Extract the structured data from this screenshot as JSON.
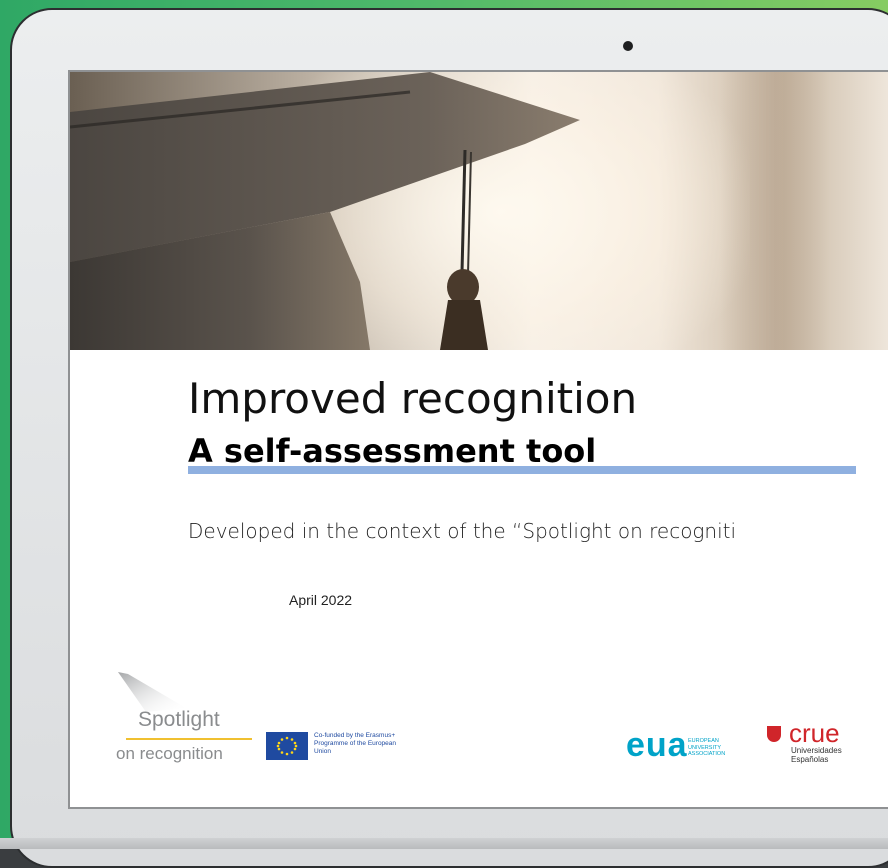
{
  "document": {
    "title": "Improved recognition",
    "subtitle": "A self-assessment tool",
    "context_text": "Developed in the context of the “Spotlight on recogniti",
    "date": "April 2022"
  },
  "logos": {
    "spotlight": {
      "line1": "Spotlight",
      "line2": "on recognition"
    },
    "eu": {
      "text": "Co-funded by the Erasmus+ Programme of the European Union"
    },
    "eua": {
      "word": "eua",
      "text": "EUROPEAN UNIVERSITY ASSOCIATION"
    },
    "crue": {
      "word": "crue",
      "text": "Universidades Españolas"
    }
  },
  "colors": {
    "underline": "#8fb0e0",
    "eua": "#00a3c8",
    "crue": "#d0252a",
    "spotlight_accent": "#f0c030",
    "eu_blue": "#1f4aa0",
    "background_gradient": "#4db86a"
  }
}
